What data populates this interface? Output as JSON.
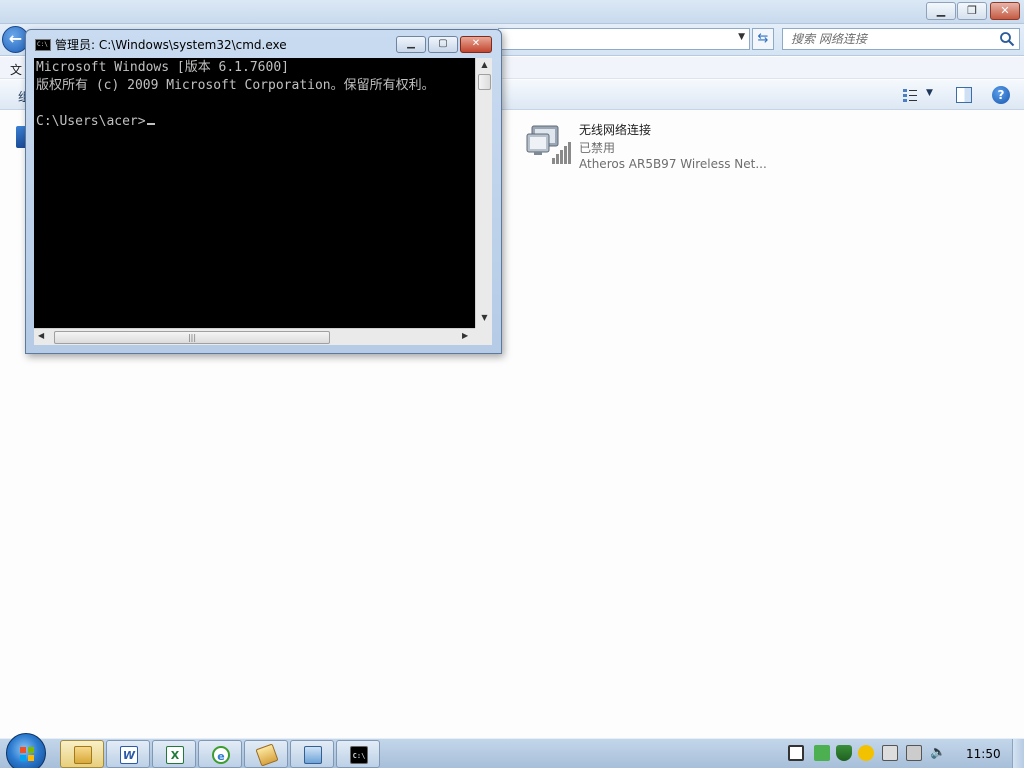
{
  "explorer": {
    "address_value": "",
    "search": {
      "placeholder": "搜索 网络连接"
    },
    "menu": {
      "file_label": "文"
    },
    "command_bar": {
      "organize_label": "组"
    },
    "connection": {
      "name": "无线网络连接",
      "status": "已禁用",
      "device": "Atheros AR5B97 Wireless Net..."
    }
  },
  "cmd": {
    "title": "管理员: C:\\Windows\\system32\\cmd.exe",
    "lines": [
      "Microsoft Windows [版本 6.1.7600]",
      "版权所有 (c) 2009 Microsoft Corporation。保留所有权利。",
      "",
      "C:\\Users\\acer>"
    ]
  },
  "taskbar": {
    "buttons": [
      {
        "name": "explorer",
        "icon": "folder-icon",
        "active": true
      },
      {
        "name": "word",
        "icon": "word-icon",
        "glyph": "W"
      },
      {
        "name": "excel",
        "icon": "excel-icon",
        "glyph": "X"
      },
      {
        "name": "ie",
        "icon": "ie-icon",
        "glyph": "e"
      },
      {
        "name": "app5",
        "icon": "app-icon"
      },
      {
        "name": "app6",
        "icon": "remote-desktop-icon"
      },
      {
        "name": "cmd",
        "icon": "cmd-icon",
        "glyph": "C:\\"
      }
    ],
    "clock": "11:50"
  },
  "colors": {
    "console_bg": "#000000",
    "console_text": "#c0c0c0",
    "taskbar_bg": "#b4cae2",
    "window_frame": "#c9dbf0"
  }
}
